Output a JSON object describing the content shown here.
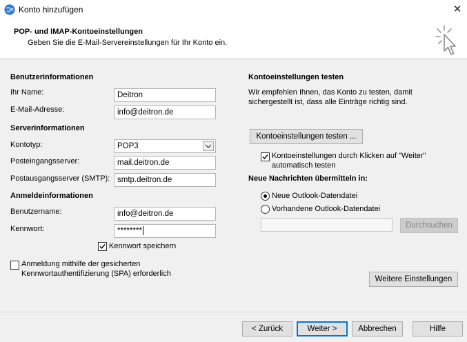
{
  "window": {
    "title": "Konto hinzufügen",
    "close_glyph": "✕"
  },
  "header": {
    "title": "POP- und IMAP-Kontoeinstellungen",
    "subtitle": "Geben Sie die E-Mail-Servereinstellungen für Ihr Konto ein."
  },
  "user_info": {
    "heading": "Benutzerinformationen",
    "name_label": "Ihr Name:",
    "name_value": "Deitron",
    "email_label": "E-Mail-Adresse:",
    "email_value": "info@deitron.de"
  },
  "server_info": {
    "heading": "Serverinformationen",
    "account_type_label": "Kontotyp:",
    "account_type_value": "POP3",
    "incoming_label": "Posteingangsserver:",
    "incoming_value": "mail.deitron.de",
    "outgoing_label": "Postausgangsserver (SMTP):",
    "outgoing_value": "smtp.deitron.de"
  },
  "logon_info": {
    "heading": "Anmeldeinformationen",
    "username_label": "Benutzername:",
    "username_value": "info@deitron.de",
    "password_label": "Kennwort:",
    "password_value": "********",
    "remember_label": "Kennwort speichern",
    "remember_checked": true,
    "spa_label_line1": "Anmeldung mithilfe der gesicherten",
    "spa_label_line2": "Kennwortauthentifizierung (SPA) erforderlich",
    "spa_checked": false
  },
  "test_settings": {
    "heading": "Kontoeinstellungen testen",
    "desc_line1": "Wir empfehlen Ihnen, das Konto zu testen, damit",
    "desc_line2": "sichergestellt ist, dass alle Einträge richtig sind.",
    "test_button": "Kontoeinstellungen testen ...",
    "auto_test_line1": "Kontoeinstellungen durch Klicken auf \"Weiter\"",
    "auto_test_line2": "automatisch testen",
    "auto_test_checked": true
  },
  "deliver": {
    "heading": "Neue Nachrichten übermitteln in:",
    "option_new": "Neue Outlook-Datendatei",
    "option_existing": "Vorhandene Outlook-Datendatei",
    "selected": "new",
    "path_value": "",
    "browse_button": "Durchsuchen"
  },
  "more_settings_button": "Weitere Einstellungen",
  "footer": {
    "back": "< Zurück",
    "next": "Weiter >",
    "cancel": "Abbrechen",
    "help": "Hilfe"
  },
  "icons": {
    "app": "outlook-globe-icon",
    "wizard": "cursor-sparkle-icon",
    "check": "✓",
    "dropdown": "chevron-down-icon"
  },
  "colors": {
    "accent": "#0078d7",
    "background": "#f0f0f0",
    "header": "#ffffff"
  }
}
